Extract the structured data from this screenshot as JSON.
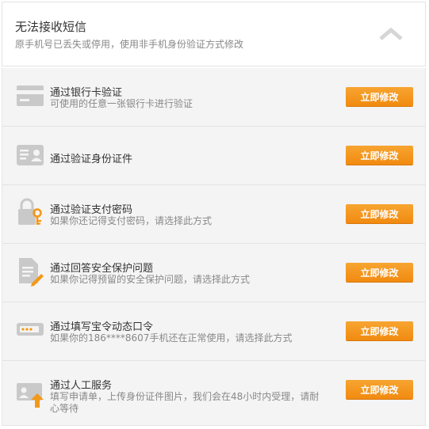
{
  "header": {
    "title": "无法接收短信",
    "subtitle": "原手机号已丢失或停用，使用非手机身份验证方式修改"
  },
  "button_label": "立即修改",
  "methods": [
    {
      "title": "通过银行卡验证",
      "desc": "可使用的任意一张银行卡进行验证",
      "icon": "bank-card-icon"
    },
    {
      "title": "通过验证身份证件",
      "desc": "",
      "icon": "id-card-icon"
    },
    {
      "title": "通过验证支付密码",
      "desc": "如果你还记得支付密码，请选择此方式",
      "icon": "lock-key-icon"
    },
    {
      "title": "通过回答安全保护问题",
      "desc": "如果你记得预留的安全保护问题，请选择此方式",
      "icon": "security-question-icon"
    },
    {
      "title": "通过填写宝令动态口令",
      "desc": "如果你的186****8607手机还在正常使用，请选择此方式",
      "icon": "token-icon"
    },
    {
      "title": "通过人工服务",
      "desc": "填写申请单，上传身份证件图片，我们会在48小时内受理，请耐心等待",
      "icon": "manual-upload-icon"
    }
  ],
  "colors": {
    "accent": "#f39817",
    "icon": "#c9c9c9"
  }
}
